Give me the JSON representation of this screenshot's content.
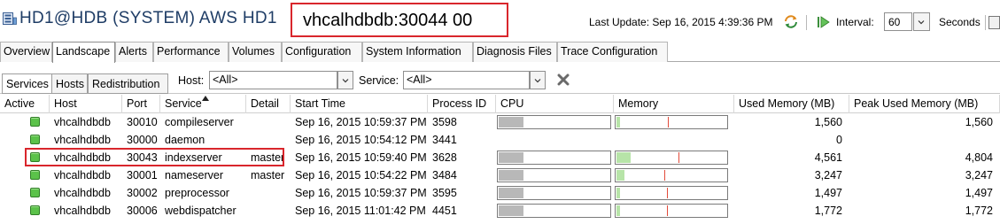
{
  "window": {
    "title": "HD1@HDB (SYSTEM) AWS HD1",
    "host_overlay": "vhcalhdbdb:30044 00",
    "last_update": "Last Update:  Sep 16, 2015 4:39:36 PM",
    "interval_label": "Interval:",
    "interval_value": "60",
    "seconds_label": "Seconds"
  },
  "main_tabs": [
    {
      "label": "Overview"
    },
    {
      "label": "Landscape"
    },
    {
      "label": "Alerts"
    },
    {
      "label": "Performance"
    },
    {
      "label": "Volumes"
    },
    {
      "label": "Configuration"
    },
    {
      "label": "System Information"
    },
    {
      "label": "Diagnosis Files"
    },
    {
      "label": "Trace Configuration"
    }
  ],
  "sub_tabs": [
    {
      "label": "Services"
    },
    {
      "label": "Hosts"
    },
    {
      "label": "Redistribution"
    }
  ],
  "filter": {
    "host_label": "Host:",
    "host_value": "<All>",
    "service_label": "Service:",
    "service_value": "<All>"
  },
  "table": {
    "columns": [
      "Active",
      "Host",
      "Port",
      "Service",
      "Detail",
      "Start Time",
      "Process ID",
      "CPU",
      "Memory",
      "Used Memory (MB)",
      "Peak Used Memory (MB)"
    ],
    "sorted_column": "Service",
    "rows": [
      {
        "host": "vhcalhdbdb",
        "port": "30010",
        "service": "compileserver",
        "detail": "",
        "start_time": "Sep 16, 2015 10:59:37 PM",
        "pid": "3598",
        "cpu": 0.22,
        "mem_used": 0.03,
        "mem_peak": 0.47,
        "used_mb": "1,560",
        "peak_mb": "1,560"
      },
      {
        "host": "vhcalhdbdb",
        "port": "30000",
        "service": "daemon",
        "detail": "",
        "start_time": "Sep 16, 2015 10:54:12 PM",
        "pid": "3441",
        "cpu": null,
        "mem_used": null,
        "mem_peak": null,
        "used_mb": "0",
        "peak_mb": ""
      },
      {
        "host": "vhcalhdbdb",
        "port": "30043",
        "service": "indexserver",
        "detail": "master",
        "start_time": "Sep 16, 2015 10:59:40 PM",
        "pid": "3628",
        "cpu": 0.22,
        "mem_used": 0.13,
        "mem_peak": 0.56,
        "used_mb": "4,561",
        "peak_mb": "4,804"
      },
      {
        "host": "vhcalhdbdb",
        "port": "30001",
        "service": "nameserver",
        "detail": "master",
        "start_time": "Sep 16, 2015 10:54:22 PM",
        "pid": "3484",
        "cpu": 0.22,
        "mem_used": 0.07,
        "mem_peak": 0.44,
        "used_mb": "3,247",
        "peak_mb": "3,247"
      },
      {
        "host": "vhcalhdbdb",
        "port": "30002",
        "service": "preprocessor",
        "detail": "",
        "start_time": "Sep 16, 2015 10:59:37 PM",
        "pid": "3595",
        "cpu": 0.22,
        "mem_used": 0.03,
        "mem_peak": 0.46,
        "used_mb": "1,497",
        "peak_mb": "1,497"
      },
      {
        "host": "vhcalhdbdb",
        "port": "30006",
        "service": "webdispatcher",
        "detail": "",
        "start_time": "Sep 16, 2015 11:01:42 PM",
        "pid": "4451",
        "cpu": 0.22,
        "mem_used": 0.03,
        "mem_peak": 0.46,
        "used_mb": "1,772",
        "peak_mb": "1,772"
      }
    ]
  },
  "colors": {
    "title_text": "#1f3d66",
    "highlight_border": "#d9262c",
    "active_green": "#5bc24a",
    "memory_fill": "#b7e4a8",
    "peak_marker": "#e24b3a",
    "cpu_fill": "#b8b8b8"
  },
  "icons": [
    "system-db-icon",
    "refresh-icon",
    "play-icon",
    "chevron-down-icon",
    "clear-filter-icon",
    "sort-arrow-icon",
    "active-status-icon"
  ]
}
